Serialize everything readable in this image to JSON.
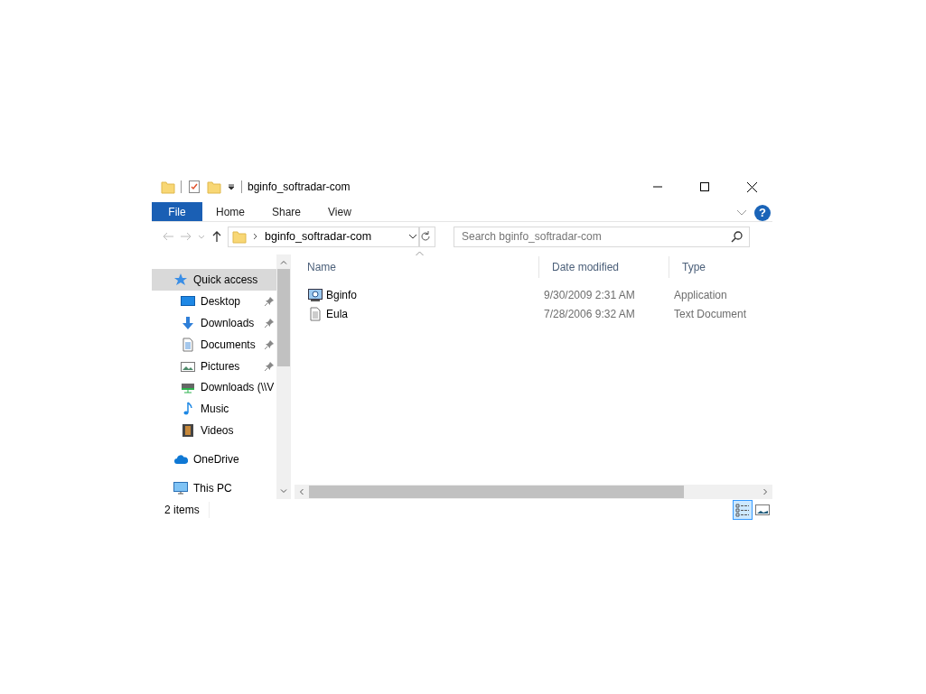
{
  "window": {
    "title": "bginfo_softradar-com"
  },
  "ribbon_tabs": [
    {
      "label": "File",
      "kind": "file"
    },
    {
      "label": "Home",
      "kind": "tab"
    },
    {
      "label": "Share",
      "kind": "tab"
    },
    {
      "label": "View",
      "kind": "tab"
    }
  ],
  "address": {
    "path": "bginfo_softradar-com"
  },
  "search": {
    "placeholder": "Search bginfo_softradar-com"
  },
  "help_button": {
    "label": "?"
  },
  "sidebar": {
    "items": [
      {
        "label": "Quick access",
        "kind": "star",
        "selected": true,
        "children": [
          {
            "label": "Desktop",
            "kind": "desktop",
            "selected": false,
            "pinned": true
          },
          {
            "label": "Downloads",
            "kind": "download",
            "selected": false,
            "pinned": true
          },
          {
            "label": "Documents",
            "kind": "document",
            "selected": false,
            "pinned": true
          },
          {
            "label": "Pictures",
            "kind": "picture",
            "selected": false,
            "pinned": true
          },
          {
            "label": "Downloads (\\\\V",
            "kind": "network",
            "selected": false,
            "pinned": false
          },
          {
            "label": "Music",
            "kind": "music",
            "selected": false,
            "pinned": false
          },
          {
            "label": "Videos",
            "kind": "video",
            "selected": false,
            "pinned": false
          }
        ]
      },
      {
        "label": "OneDrive",
        "kind": "cloud",
        "selected": false
      },
      {
        "label": "This PC",
        "kind": "pc",
        "selected": false
      }
    ]
  },
  "columns": [
    {
      "label": "Name",
      "sorted": true
    },
    {
      "label": "Date modified",
      "sorted": false
    },
    {
      "label": "Type",
      "sorted": false
    }
  ],
  "rows": [
    {
      "name": "Bginfo",
      "date": "9/30/2009 2:31 AM",
      "type": "Application",
      "kind": "app"
    },
    {
      "name": "Eula",
      "date": "7/28/2006 9:32 AM",
      "type": "Text Document",
      "kind": "text"
    }
  ],
  "status_bar": {
    "count": "2 items"
  },
  "view_buttons": [
    {
      "kind": "details",
      "selected": true
    },
    {
      "kind": "tiles",
      "selected": false
    }
  ]
}
